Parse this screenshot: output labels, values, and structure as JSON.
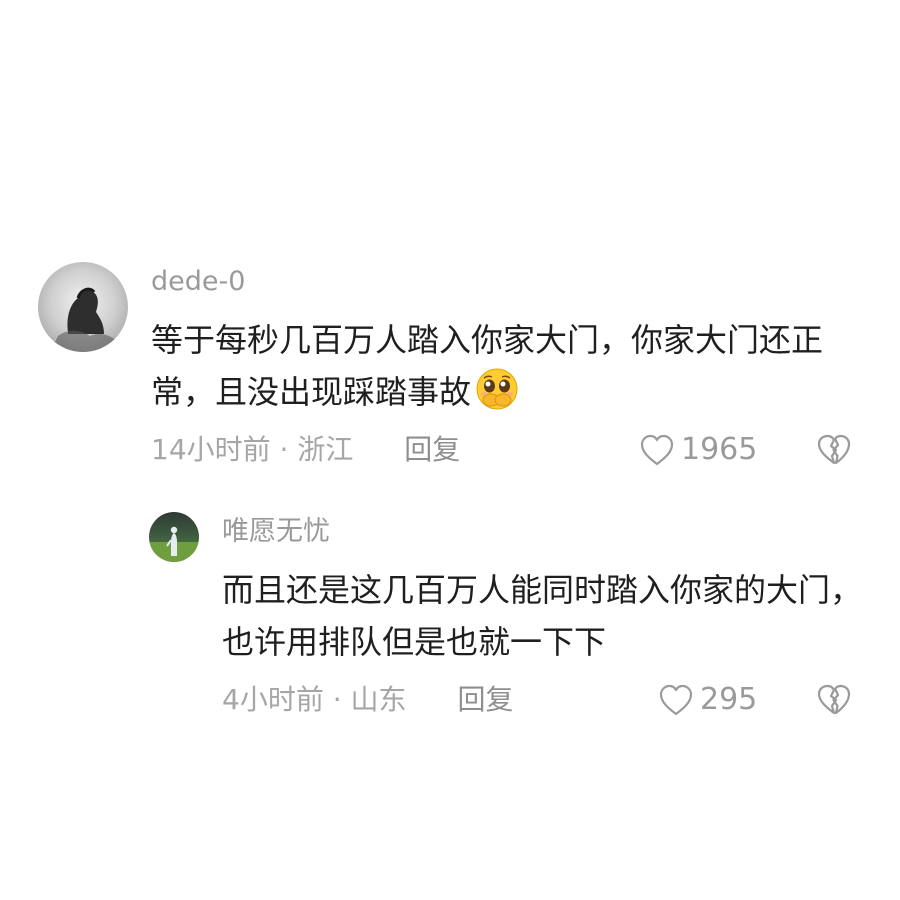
{
  "comments": [
    {
      "username": "dede-0",
      "text": "等于每秒几百万人踏入你家大门，你家大门还正常，且没出现踩踏事故",
      "emoji": "pleading-face-emoji",
      "time_location": "14小时前 · 浙江",
      "reply_label": "回复",
      "likes": "1965"
    },
    {
      "username": "唯愿无忧",
      "text": "而且还是这几百万人能同时踏入你家的大门，也许用排队但是也就一下下",
      "time_location": "4小时前 · 山东",
      "reply_label": "回复",
      "likes": "295"
    }
  ]
}
